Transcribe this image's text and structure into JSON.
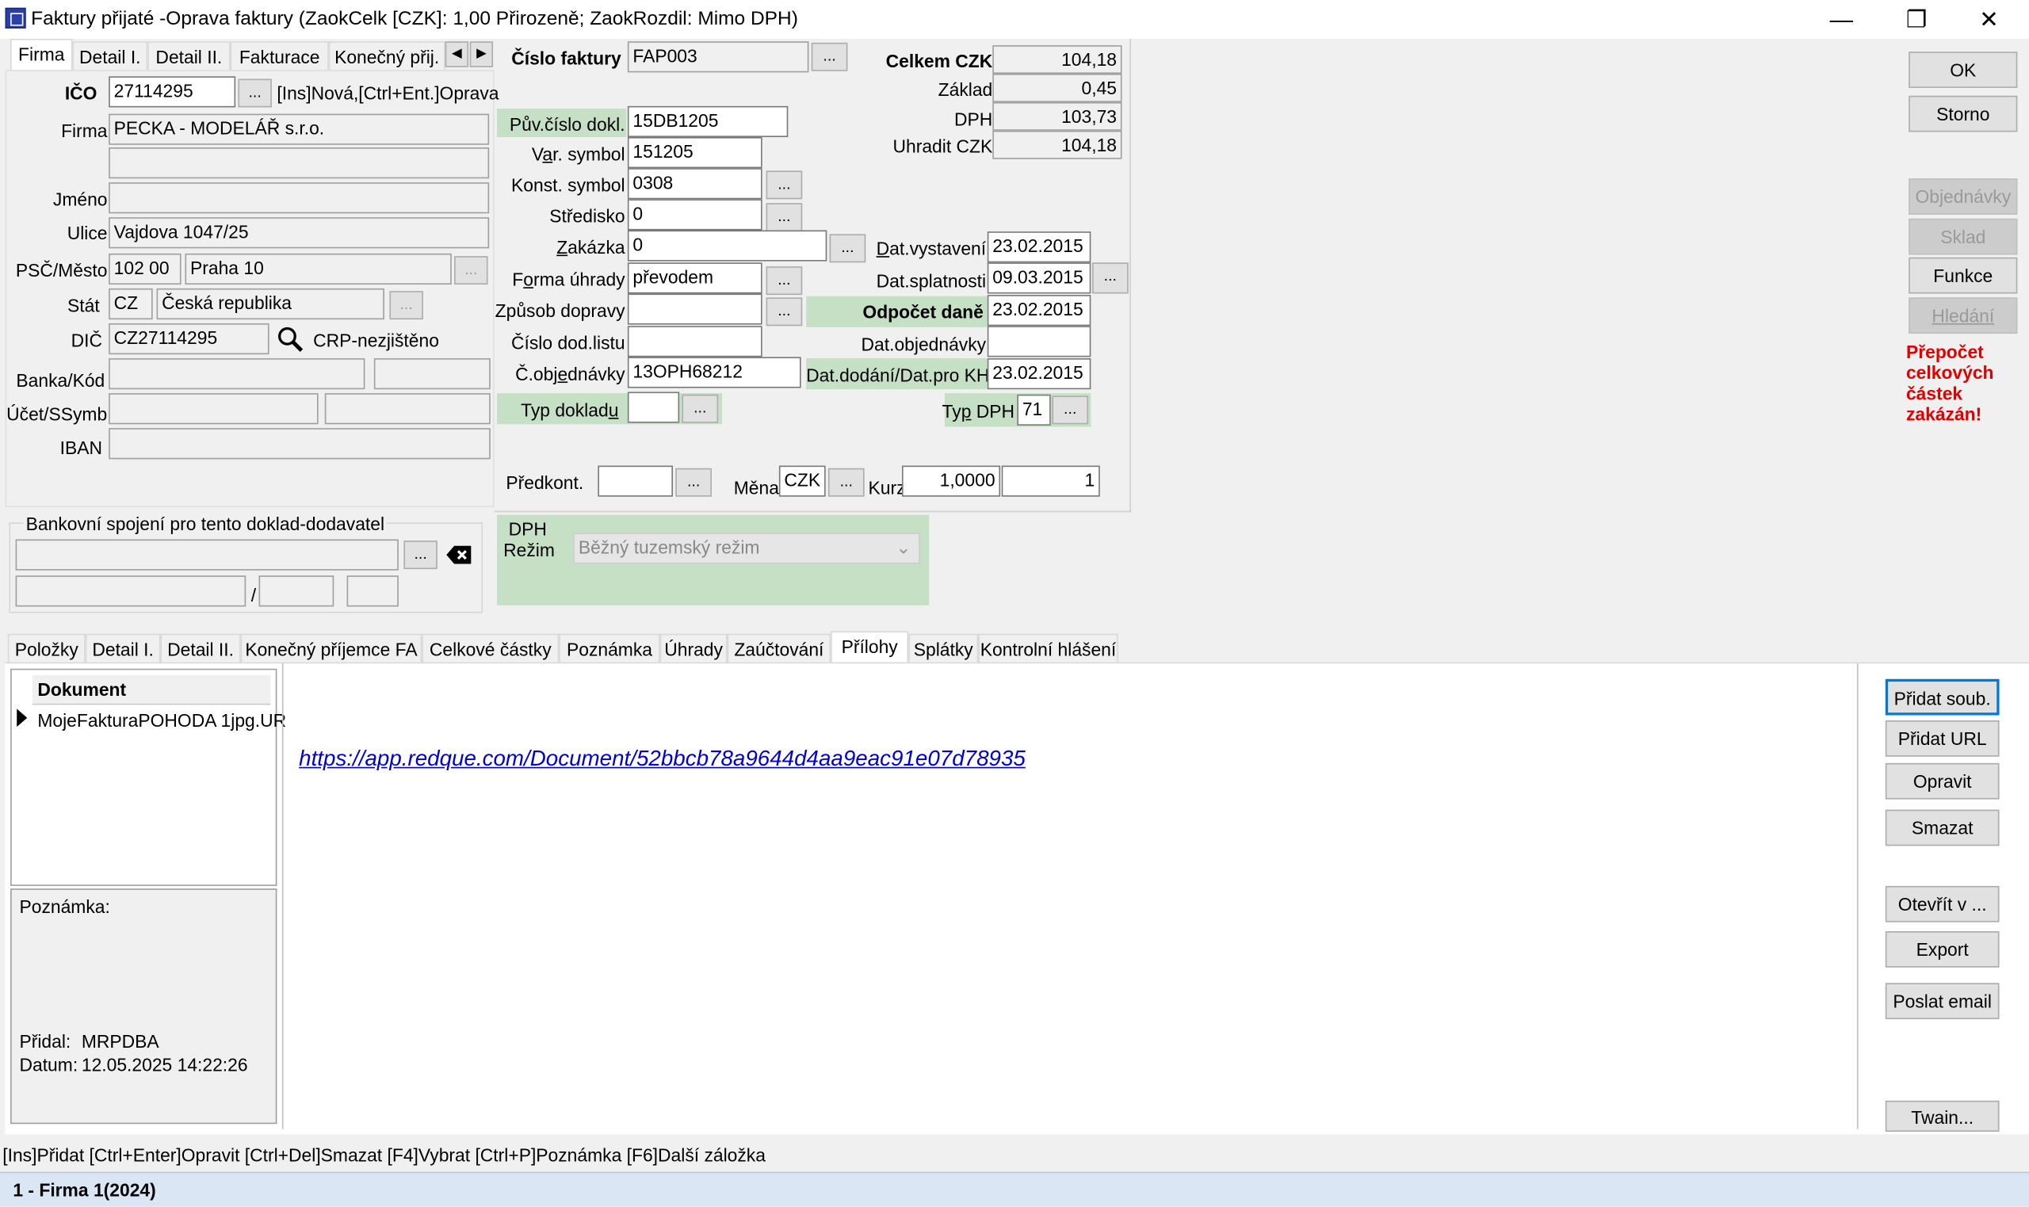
{
  "window": {
    "title": "Faktury přijaté -Oprava faktury  (ZaokCelk [CZK]: 1,00 Přirozeně; ZaokRozdil: Mimo DPH)",
    "minimize": "—",
    "maximize": "❐",
    "close": "✕"
  },
  "top_tabs": [
    "Firma",
    "Detail I.",
    "Detail II.",
    "Fakturace",
    "Konečný přij."
  ],
  "firma": {
    "ico_label": "IČO",
    "ico": "27114295",
    "ico_hint": "[Ins]Nová,[Ctrl+Ent.]Oprava",
    "firma_label": "Firma",
    "firma": "PECKA - MODELÁŘ s.r.o.",
    "jmeno_label": "Jméno",
    "ulice_label": "Ulice",
    "ulice": "Vajdova 1047/25",
    "psc_label": "PSČ/Město",
    "psc": "102 00",
    "mesto": "Praha 10",
    "stat_label": "Stát",
    "stat_code": "CZ",
    "stat": "Česká republika",
    "dic_label": "DIČ",
    "dic": "CZ27114295",
    "crp": "CRP-nezjištěno",
    "banka_label": "Banka/Kód",
    "ucet_label": "Účet/SSymb",
    "iban_label": "IBAN"
  },
  "bank": {
    "title": "Bankovní spojení pro tento doklad-dodavatel",
    "slash": "/"
  },
  "invoice": {
    "cislo_label": "Číslo faktury",
    "cislo": "FAP003",
    "puv_label": "Pův.číslo dokl.",
    "puv": "15DB1205",
    "var_label": "Var. symbol",
    "var": "151205",
    "konst_label": "Konst. symbol",
    "konst": "0308",
    "stredisko_label": "Středisko",
    "stredisko": "0",
    "zakazka_label": "Zakázka",
    "zakazka": "0",
    "forma_label": "Forma úhrady",
    "forma": "převodem",
    "doprava_label": "Způsob dopravy",
    "dodlist_label": "Číslo dod.listu",
    "objednavky_label": "Č.objednávky",
    "objednavky": "13OPH68212",
    "typdokl_label": "Typ dokladu",
    "dat_vyst_label": "Dat.vystavení",
    "dat_vyst": "23.02.2015",
    "dat_spl_label": "Dat.splatnosti",
    "dat_spl": "09.03.2015",
    "odpocet_label": "Odpočet daně",
    "odpocet": "23.02.2015",
    "dat_obj_label": "Dat.objednávky",
    "dat_dod_label": "Dat.dodání/Dat.pro KH",
    "dat_dod": "23.02.2015",
    "typdph_label": "Typ DPH",
    "typdph": "71",
    "predkont_label": "Předkont.",
    "mena_label": "Měna",
    "mena": "CZK",
    "kurz_label": "Kurz",
    "kurz": "1,0000",
    "kurz_mn": "1",
    "dots": "..."
  },
  "totals": {
    "celkem_label": "Celkem CZK",
    "celkem": "104,18",
    "zaklad_label": "Základ",
    "zaklad": "0,45",
    "dph_label": "DPH",
    "dph": "103,73",
    "uhradit_label": "Uhradit CZK",
    "uhradit": "104,18"
  },
  "dph_box": {
    "title": "DPH",
    "rezim_label": "Režim",
    "rezim": "Běžný tuzemský režim"
  },
  "right_buttons": {
    "ok": "OK",
    "storno": "Storno",
    "objednavky": "Objednávky",
    "sklad": "Sklad",
    "funkce": "Funkce",
    "hledani": "Hledání",
    "warning": "Přepočet celkových částek zakázán!"
  },
  "bottom_tabs": [
    "Položky",
    "Detail I.",
    "Detail II.",
    "Konečný příjemce FA",
    "Celkové částky",
    "Poznámka",
    "Úhrady",
    "Zaúčtování",
    "Přílohy",
    "Splátky",
    "Kontrolní hlášení"
  ],
  "attachments": {
    "column": "Dokument",
    "rows": [
      "MojeFakturaPOHODA 1jpg.UR"
    ],
    "link": "https://app.redque.com/Document/52bbcb78a9644d4aa9eac91e07d78935",
    "note_label": "Poznámka:",
    "pridal_label": "Přidal:",
    "pridal": "MRPDBA",
    "datum_label": "Datum:",
    "datum": "12.05.2025 14:22:26",
    "buttons": [
      "Přidat soub.",
      "Přidat URL",
      "Opravit",
      "Smazat",
      "Otevřít v ...",
      "Export",
      "Poslat email",
      "Twain..."
    ]
  },
  "status": {
    "hint": "[Ins]Přidat [Ctrl+Enter]Opravit [Ctrl+Del]Smazat [F4]Vybrat [Ctrl+P]Poznámka [F6]Další záložka",
    "firm": "1 - Firma 1(2024)"
  },
  "colors": {
    "green": "#c6e0c6",
    "warning": "#e00000",
    "link": "#0000cc",
    "status_bar": "#dbe6f4"
  }
}
